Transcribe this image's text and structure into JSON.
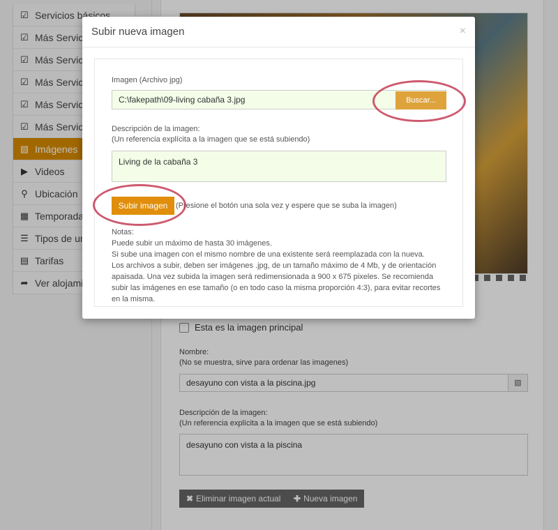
{
  "sidebar": {
    "items": [
      {
        "label": "Servicios básicos",
        "icon": "check-square-icon",
        "glyph": "☑"
      },
      {
        "label": "Más Servicios",
        "icon": "check-square-icon",
        "glyph": "☑"
      },
      {
        "label": "Más Servicios",
        "icon": "check-square-icon",
        "glyph": "☑"
      },
      {
        "label": "Más Servicios",
        "icon": "check-square-icon",
        "glyph": "☑"
      },
      {
        "label": "Más Servicios",
        "icon": "check-square-icon",
        "glyph": "☑"
      },
      {
        "label": "Más Servicios",
        "icon": "check-square-icon",
        "glyph": "☑"
      },
      {
        "label": "Imágenes",
        "icon": "image-icon",
        "glyph": "▧",
        "active": true
      },
      {
        "label": "Videos",
        "icon": "video-play-icon",
        "glyph": "▶"
      },
      {
        "label": "Ubicación",
        "icon": "map-marker-icon",
        "glyph": "⚲"
      },
      {
        "label": "Temporadas",
        "icon": "calendar-icon",
        "glyph": "▦"
      },
      {
        "label": "Tipos de unidad",
        "icon": "list-icon",
        "glyph": "☰"
      },
      {
        "label": "Tarifas",
        "icon": "table-icon",
        "glyph": "▤"
      },
      {
        "label": "Ver alojamiento",
        "icon": "share-arrow-icon",
        "glyph": "➦"
      }
    ]
  },
  "background_form": {
    "principal_checkbox_label": "Esta es la imagen principal",
    "nombre_label": "Nombre:",
    "nombre_help": "(No se muestra, sirve para ordenar las imagenes)",
    "nombre_value": "desayuno con vista a la piscina.jpg",
    "descripcion_label": "Descripción de la imagen:",
    "descripcion_help": "(Un referencia explícita a la imagen que se está subiendo)",
    "descripcion_value": "desayuno con vista a la piscina",
    "delete_button": "Eliminar imagen actual",
    "new_button": "Nueva imagen"
  },
  "modal": {
    "title": "Subir nueva imagen",
    "close": "×",
    "file_label": "Imagen (Archivo jpg)",
    "file_value": "C:\\fakepath\\09-living cabaña 3.jpg",
    "browse_button": "Buscar...",
    "desc_label": "Descripción de la imagen:",
    "desc_help": "(Un referencia explícita a la imagen que se está subiendo)",
    "desc_value": "Living de la cabaña 3",
    "upload_button": "Subir imagen",
    "upload_hint": "(Presione el botón una sola vez y espere que se suba la imagen)",
    "notes": [
      "Notas:",
      "Puede subir un máximo de hasta 30 imágenes.",
      "Si sube una imagen con el mismo nombre de una existente será reemplazada con la nueva.",
      "Los archivos a subir, deben ser imágenes .jpg, de un tamaño máximo de 4 Mb, y de orientación apaisada. Una vez subida la imagen será redimensionada a 900 x 675 pixeles. Se recomienda subir las imágenes en ese tamaño (o en todo caso la misma proporción 4:3), para evitar recortes en la misma."
    ]
  },
  "colors": {
    "accent": "#e08e0b",
    "annotation": "#c0304a",
    "input_bg": "#f3fde8"
  }
}
